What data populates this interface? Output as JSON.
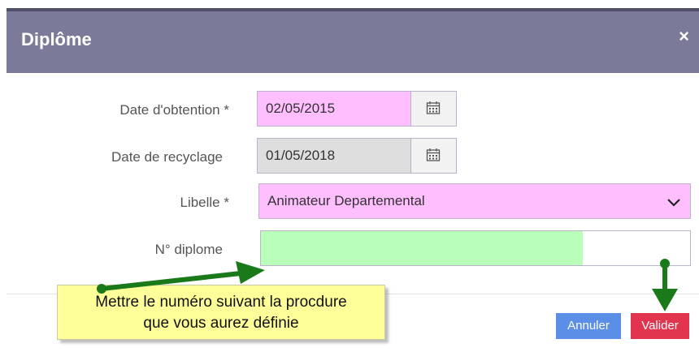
{
  "dialog": {
    "title": "Diplôme",
    "close_label": "×"
  },
  "form": {
    "date_obtention": {
      "label": "Date d'obtention",
      "required_mark": "*",
      "value": "02/05/2015"
    },
    "date_recyclage": {
      "label": "Date de recyclage",
      "value": "01/05/2018"
    },
    "libelle": {
      "label": "Libelle",
      "required_mark": "*",
      "selected": "Animateur Departemental"
    },
    "numero": {
      "label": "N° diplome",
      "value": ""
    }
  },
  "footer": {
    "cancel_label": "Annuler",
    "validate_label": "Valider"
  },
  "annotation": {
    "line1": "Mettre le numéro suivant la procdure",
    "line2": "que vous aurez définie"
  },
  "colors": {
    "header": "#7b7b99",
    "required_highlight": "#ffbfff",
    "numero_highlight": "#b9ffb9",
    "cancel": "#5b8ee6",
    "validate": "#e0344f",
    "arrow": "#1a7a1a"
  },
  "icons": {
    "calendar": "calendar-icon",
    "dropdown": "chevron-down-icon",
    "close": "close-icon"
  }
}
